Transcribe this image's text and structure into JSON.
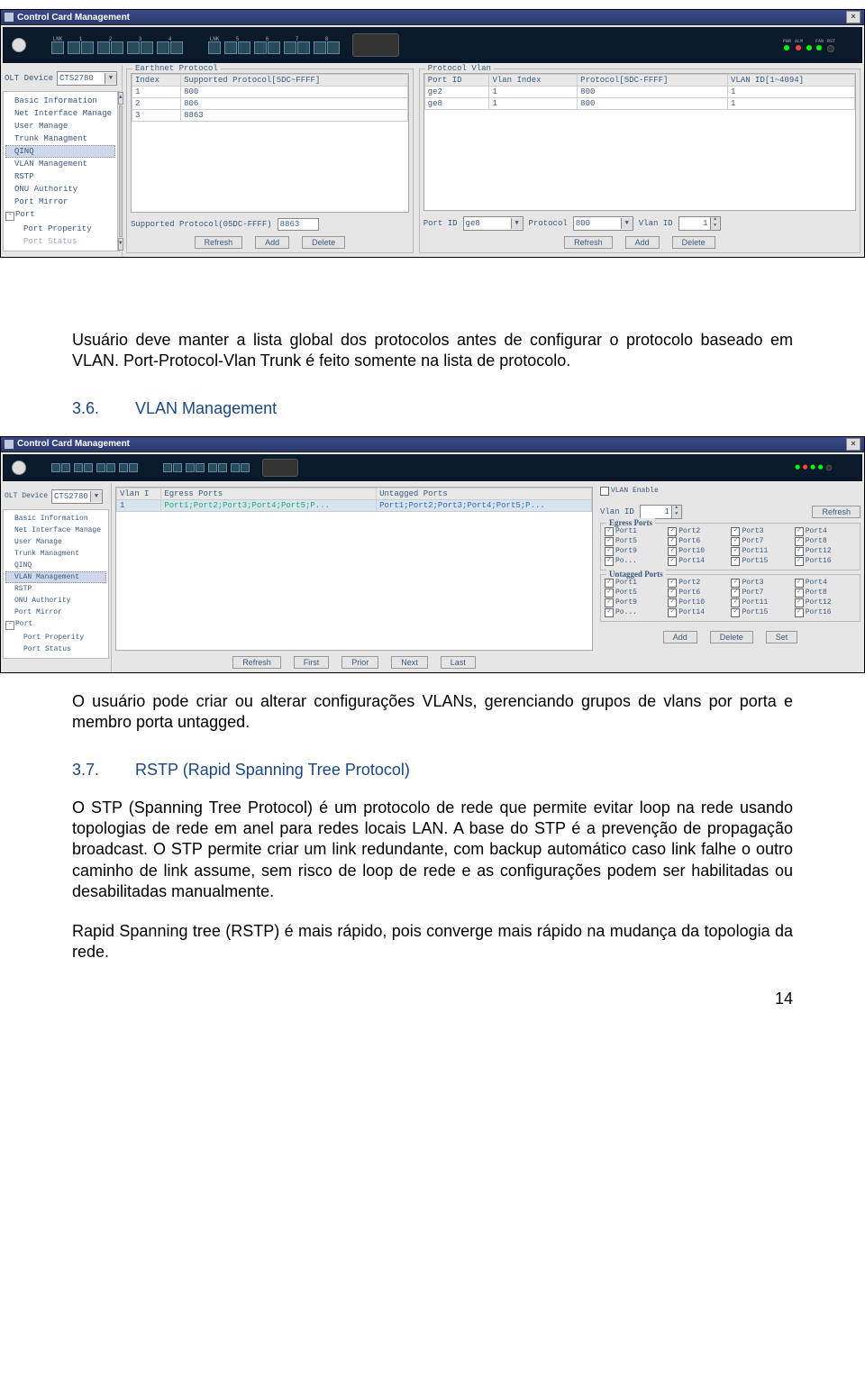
{
  "window_title": "Control Card Management",
  "olt_device_label": "OLT Device",
  "olt_device_value": "CTS2780",
  "nav_items": [
    "Basic Information",
    "Net Interface Manage",
    "User Manage",
    "Trunk Managment",
    "QINQ",
    "VLAN Management",
    "RSTP",
    "ONU Authority",
    "Port Mirror",
    "Port",
    "Port Properity",
    "Port Status"
  ],
  "sc1": {
    "group1_title": "Earthnet Protocol",
    "g1_headers": [
      "Index",
      "Supported Protocol[5DC~FFFF]"
    ],
    "g1_rows": [
      [
        "1",
        "800"
      ],
      [
        "2",
        "806"
      ],
      [
        "3",
        "8863"
      ]
    ],
    "g1_field_label": "Supported Protocol(05DC-FFFF)",
    "g1_field_value": "8863",
    "g1_buttons": [
      "Refresh",
      "Add",
      "Delete"
    ],
    "group2_title": "Protocol Vlan",
    "g2_headers": [
      "Port ID",
      "Vlan Index",
      "Protocol[5DC-FFFF]",
      "VLAN ID[1~4094]"
    ],
    "g2_rows": [
      [
        "ge2",
        "1",
        "800",
        "1"
      ],
      [
        "ge8",
        "1",
        "800",
        "1"
      ]
    ],
    "g2_port_label": "Port ID",
    "g2_port_value": "ge8",
    "g2_proto_label": "Protocol",
    "g2_proto_value": "800",
    "g2_vlan_label": "Vlan ID",
    "g2_vlan_value": "1",
    "g2_buttons": [
      "Refresh",
      "Add",
      "Delete"
    ]
  },
  "sections": {
    "s35_num": "3.6.",
    "s35_title": "VLAN Management",
    "s37_num": "3.7.",
    "s37_title": "RSTP (Rapid Spanning Tree Protocol)"
  },
  "paragraphs": {
    "p1": "Usuário deve manter a lista global dos protocolos antes de configurar o protocolo baseado em VLAN. Port-Protocol-Vlan Trunk é feito somente na lista de protocolo.",
    "p2": "O usuário pode criar ou alterar configurações VLANs, gerenciando grupos de vlans por porta e membro porta untagged.",
    "p3": "O STP (Spanning Tree Protocol) é um protocolo de rede que permite evitar loop na rede usando topologias de rede em anel para redes locais LAN. A base do STP é a prevenção de propagação broadcast. O STP permite criar um link redundante, com backup automático caso link falhe o outro caminho de link assume, sem risco de loop de rede e as configurações podem ser habilitadas ou desabilitadas manualmente.",
    "p4": "Rapid Spanning tree (RSTP) é mais rápido, pois converge mais rápido na mudança da topologia da rede."
  },
  "sc2": {
    "table_headers": [
      "Vlan I",
      "Egress Ports",
      "Untagged Ports"
    ],
    "table_row": [
      "1",
      "Port1;Port2;Port3;Port4;Port5;P...",
      "Port1;Port2;Port3;Port4;Port5;P..."
    ],
    "table_buttons": [
      "Refresh",
      "First",
      "Prior",
      "Next",
      "Last"
    ],
    "vlan_enable": "VLAN Enable",
    "vlan_id_label": "Vlan ID",
    "vlan_id_value": "1",
    "refresh_btn": "Refresh",
    "egress_title": "Egress Ports",
    "untagged_title": "Untagged Ports",
    "port_rows": [
      [
        "Port1",
        "Port2",
        "Port3",
        "Port4"
      ],
      [
        "Port5",
        "Port6",
        "Port7",
        "Port8"
      ],
      [
        "Port9",
        "Port10",
        "Port11",
        "Port12"
      ],
      [
        "Po...",
        "Port14",
        "Port15",
        "Port16"
      ]
    ],
    "side_buttons": [
      "Add",
      "Delete",
      "Set"
    ]
  },
  "page_number": "14"
}
